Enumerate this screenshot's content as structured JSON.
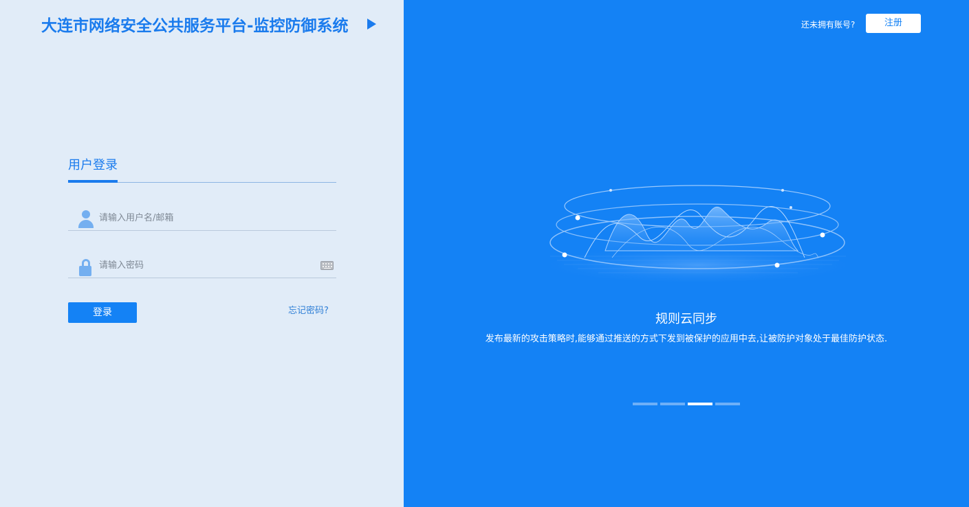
{
  "header": {
    "title": "大连市网络安全公共服务平台-监控防御系统",
    "arrow_icon": "triangle-right-icon"
  },
  "login": {
    "tab_label": "用户登录",
    "username_placeholder": "请输入用户名/邮箱",
    "username_value": "",
    "password_placeholder": "请输入密码",
    "password_value": "",
    "icons": {
      "user": "user-icon",
      "lock": "lock-icon",
      "keyboard": "keyboard-icon"
    },
    "submit_label": "登录",
    "forgot_label": "忘记密码?"
  },
  "top_right": {
    "prompt": "还未拥有账号?",
    "register_label": "注册"
  },
  "carousel": {
    "title": "规则云同步",
    "description": "发布最新的攻击策略时,能够通过推送的方式下发到被保护的应用中去,让被防护对象处于最佳防护状态.",
    "slide_count": 4,
    "active_index": 2
  },
  "colors": {
    "accent": "#1482f5",
    "left_background": "#e1ecf8",
    "title_blue": "#1a7bed"
  }
}
